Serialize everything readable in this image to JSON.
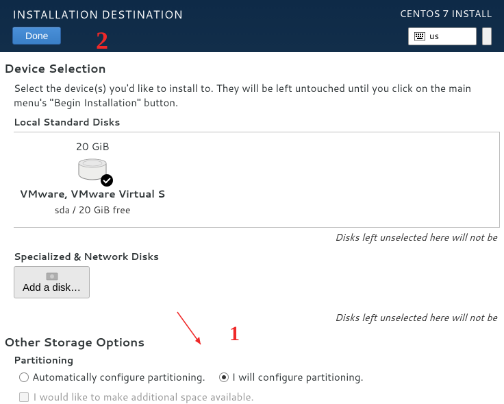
{
  "header": {
    "title": "INSTALLATION DESTINATION",
    "done_label": "Done",
    "installer_title": "CENTOS 7 INSTALL",
    "keyboard": "us"
  },
  "device_selection": {
    "title": "Device Selection",
    "description": "Select the device(s) you'd like to install to.  They will be left untouched until you click on the main menu's \"Begin Installation\" button.",
    "local_disks_label": "Local Standard Disks",
    "disks": [
      {
        "size": "20 GiB",
        "name": "VMware, VMware Virtual S",
        "detail": "sda    /    20 GiB free",
        "selected": true
      }
    ],
    "unselected_hint": "Disks left unselected here will not be ",
    "network_disks_label": "Specialized & Network Disks",
    "add_disk_label": "Add a disk…"
  },
  "other_options": {
    "title": "Other Storage Options",
    "partitioning_label": "Partitioning",
    "auto_label": "Automatically configure partitioning.",
    "manual_label": "I will configure partitioning.",
    "selected": "manual",
    "addl_space_label": "I would like to make additional space available."
  },
  "annotations": {
    "mark1": "1",
    "mark2": "2"
  }
}
